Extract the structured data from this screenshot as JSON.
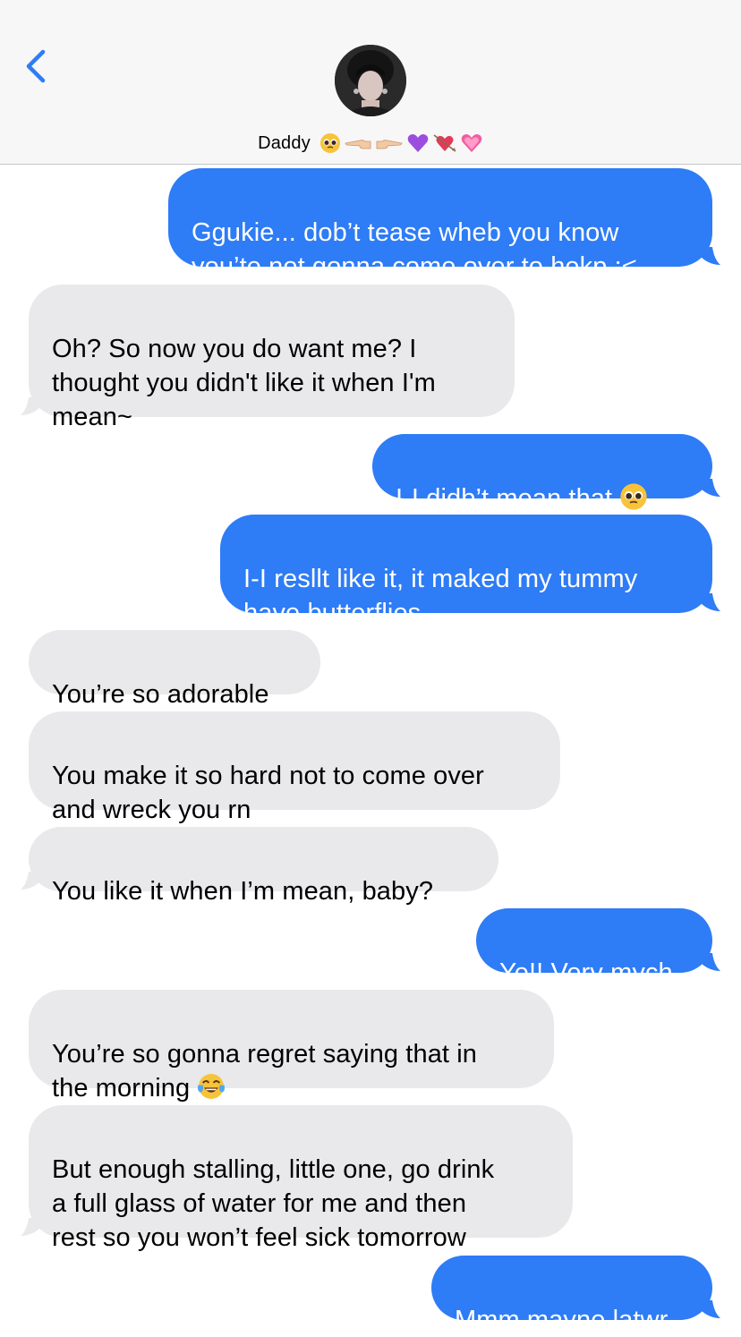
{
  "header": {
    "contact_name": "Daddy",
    "name_emojis": [
      "pleading-face-emoji",
      "pointing-left-emoji",
      "pointing-right-emoji",
      "purple-heart-emoji",
      "heart-with-arrow-emoji",
      "sparkling-heart-emoji"
    ]
  },
  "colors": {
    "sent_bubble": "#2e7cf6",
    "received_bubble": "#e9e9eb",
    "accent": "#2e7cf6"
  },
  "messages": [
    {
      "direction": "sent",
      "text": "Ggukie... dob’t tease wheb you know\nyou’te not gonna come over to hekp :<"
    },
    {
      "direction": "received",
      "text": "Oh? So now you do want me? I\nthought you didn't like it when I'm\nmean~"
    },
    {
      "direction": "sent",
      "text": "I-I didb’t mean that",
      "emoji": "pleading-face-emoji"
    },
    {
      "direction": "sent",
      "text": "I-I resllt like it, it maked my tummy\nhave butterflies"
    },
    {
      "direction": "received",
      "text": "You’re so adorable"
    },
    {
      "direction": "received",
      "text": "You make it so hard not to come over\nand wreck you rn"
    },
    {
      "direction": "received",
      "text": "You like it when I’m mean, baby?"
    },
    {
      "direction": "sent",
      "text": "Ye!! Very mych"
    },
    {
      "direction": "received",
      "text": "You’re so gonna regret saying that in\nthe morning",
      "emoji": "tears-of-joy-emoji"
    },
    {
      "direction": "received",
      "text": "But enough stalling, little one, go drink\na full glass of water for me and then\nrest so you won’t feel sick tomorrow"
    },
    {
      "direction": "sent",
      "text": "Mmm mayne latwr"
    }
  ]
}
